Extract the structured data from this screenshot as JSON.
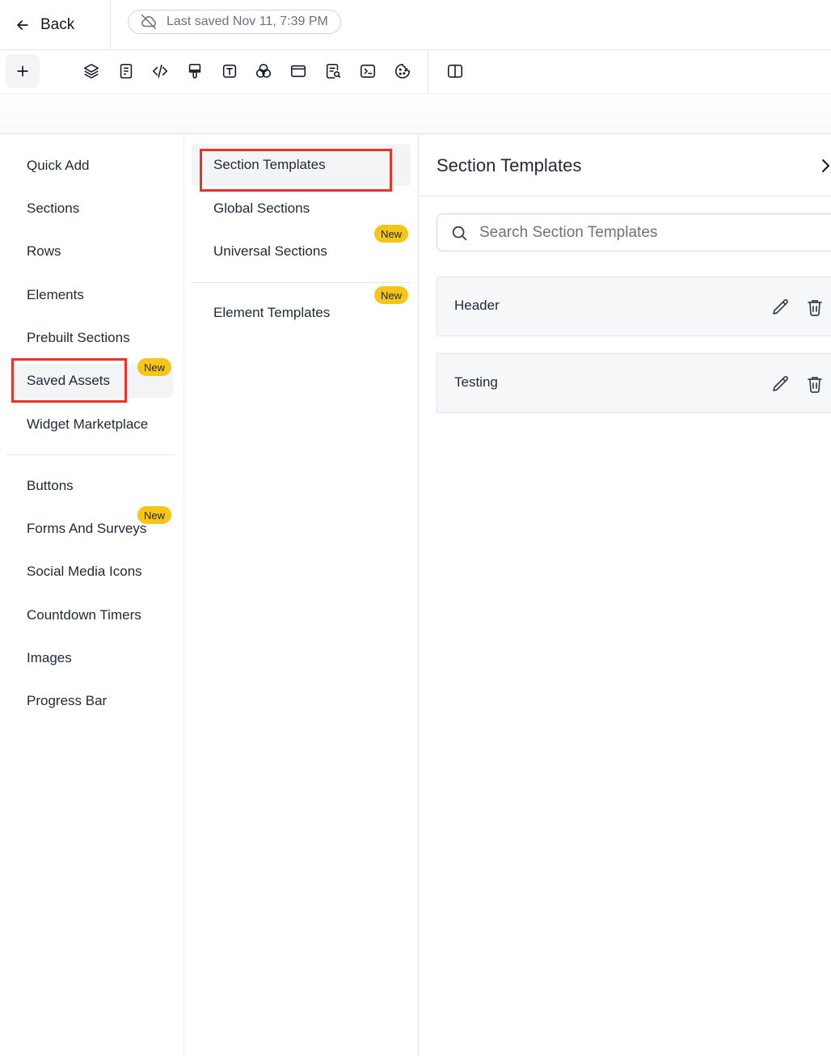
{
  "header": {
    "back_label": "Back",
    "save_status": "Last saved Nov 11, 7:39 PM"
  },
  "toolbar": {
    "tools": [
      "plus-icon",
      "layers-icon",
      "page-icon",
      "code-icon",
      "paint-brush-icon",
      "text-icon",
      "color-blend-icon",
      "window-icon",
      "page-search-icon",
      "terminal-icon",
      "cookie-icon",
      "split-view-icon"
    ]
  },
  "categories": {
    "items": [
      {
        "label": "Quick Add"
      },
      {
        "label": "Sections"
      },
      {
        "label": "Rows"
      },
      {
        "label": "Elements"
      },
      {
        "label": "Prebuilt Sections"
      },
      {
        "label": "Saved Assets",
        "active": true,
        "badge": "New"
      },
      {
        "label": "Widget Marketplace"
      }
    ],
    "items2": [
      {
        "label": "Buttons"
      },
      {
        "label": "Forms And Surveys",
        "badge": "New"
      },
      {
        "label": "Social Media Icons"
      },
      {
        "label": "Countdown Timers"
      },
      {
        "label": "Images"
      },
      {
        "label": "Progress Bar"
      }
    ]
  },
  "subcategories": {
    "items": [
      {
        "label": "Section Templates",
        "active": true
      },
      {
        "label": "Global Sections"
      },
      {
        "label": "Universal Sections",
        "badge": "New"
      },
      {
        "label": "Element Templates",
        "badge": "New"
      }
    ]
  },
  "panel": {
    "title": "Section Templates",
    "search_placeholder": "Search Section Templates",
    "templates": [
      {
        "name": "Header"
      },
      {
        "name": "Testing"
      }
    ]
  },
  "colors": {
    "highlight": "#e8322a",
    "badge": "#f5c518"
  }
}
